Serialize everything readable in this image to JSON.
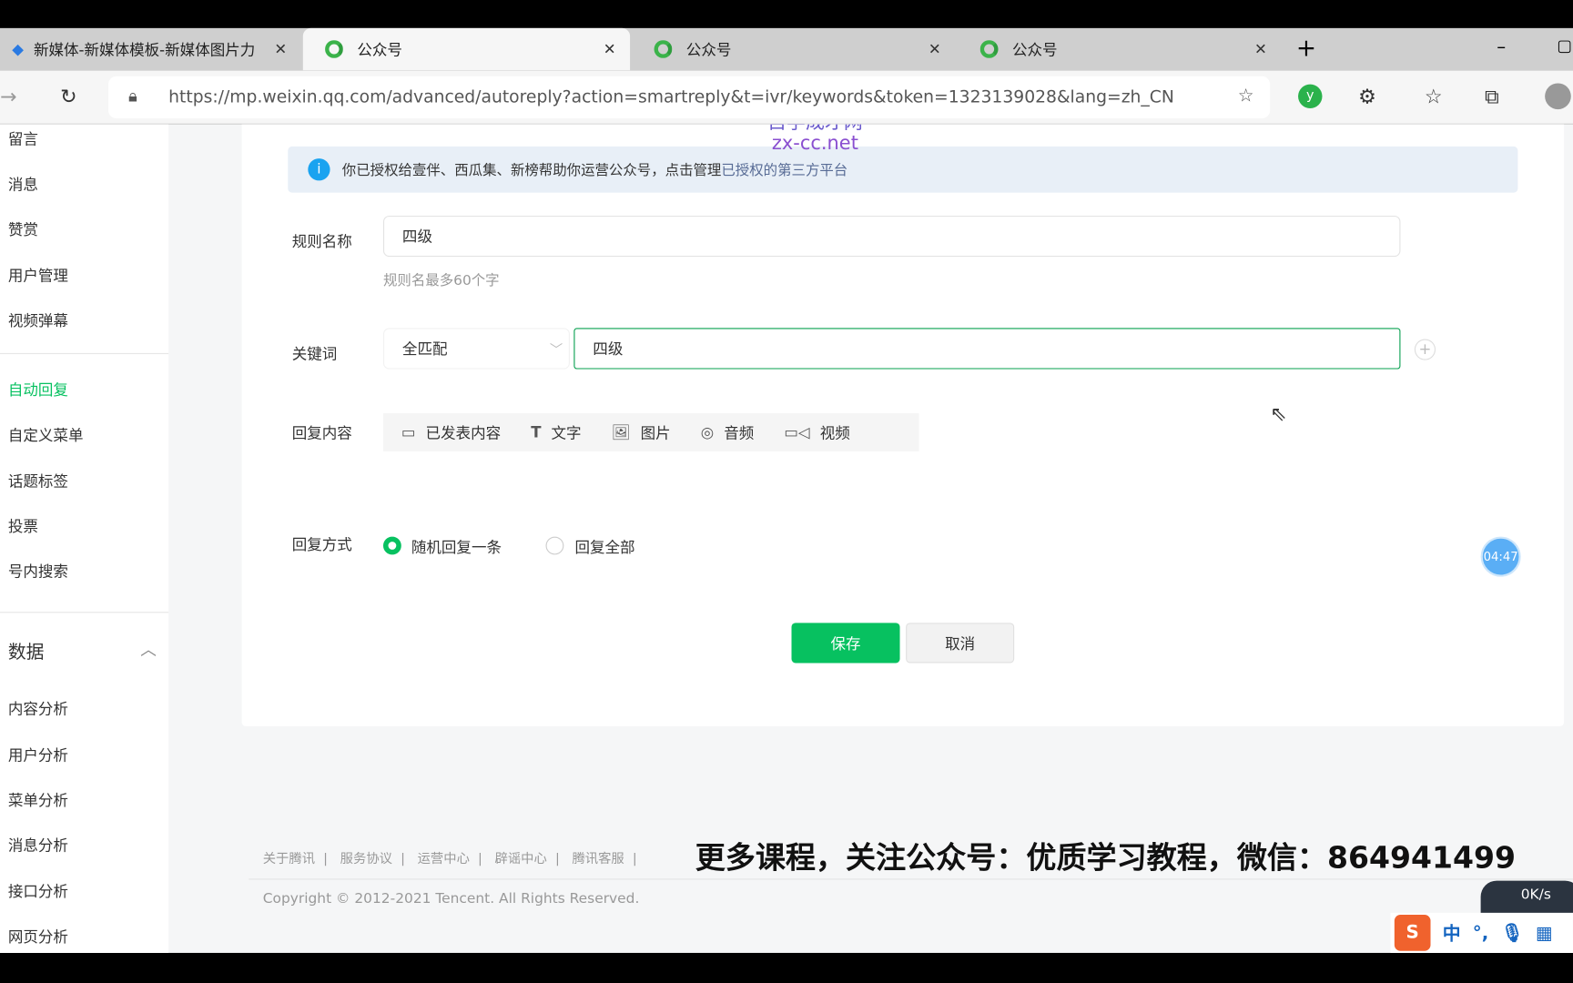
{
  "browser": {
    "tabs": [
      {
        "title": "新媒体-新媒体模板-新媒体图片力"
      },
      {
        "title": "公众号",
        "active": true
      },
      {
        "title": "公众号"
      },
      {
        "title": "公众号"
      }
    ],
    "url": "https://mp.weixin.qq.com/advanced/autoreply?action=smartreply&t=ivr/keywords&token=1323139028&lang=zh_CN"
  },
  "watermark": {
    "line1": "自学成才网",
    "line2": "zx-cc.net"
  },
  "sidebar": {
    "items": [
      "留言",
      "消息",
      "赞赏",
      "用户管理",
      "视频弹幕",
      "自动回复",
      "自定义菜单",
      "话题标签",
      "投票",
      "号内搜索"
    ],
    "active": "自动回复",
    "section": "数据",
    "data_items": [
      "内容分析",
      "用户分析",
      "菜单分析",
      "消息分析",
      "接口分析",
      "网页分析"
    ]
  },
  "notice": {
    "text": "你已授权给壹伴、西瓜集、新榜帮助你运营公众号，点击管理",
    "link": "已授权的第三方平台"
  },
  "form": {
    "rule_name_label": "规则名称",
    "rule_name_value": "四级",
    "rule_name_hint": "规则名最多60个字",
    "keyword_label": "关键词",
    "match_mode": "全匹配",
    "keyword_value": "四级",
    "reply_content_label": "回复内容",
    "content_types": [
      {
        "icon": "published-icon",
        "label": "已发表内容"
      },
      {
        "icon": "text-icon",
        "label": "文字"
      },
      {
        "icon": "image-icon",
        "label": "图片"
      },
      {
        "icon": "audio-icon",
        "label": "音频"
      },
      {
        "icon": "video-icon",
        "label": "视频"
      }
    ],
    "reply_mode_label": "回复方式",
    "reply_modes": [
      "随机回复一条",
      "回复全部"
    ],
    "reply_mode_selected": "随机回复一条",
    "save": "保存",
    "cancel": "取消"
  },
  "timer": "04:47",
  "footer": {
    "links": [
      "关于腾讯",
      "服务协议",
      "运营中心",
      "辟谣中心",
      "腾讯客服"
    ],
    "copyright": "Copyright © 2012-2021 Tencent. All Rights Reserved."
  },
  "overlay_caption": "更多课程，关注公众号：优质学习教程，微信：864941499",
  "netspeed": "0K/s",
  "ime": [
    "中",
    "°,"
  ],
  "colors": {
    "accent": "#07c160",
    "info": "#1aa3f0"
  }
}
